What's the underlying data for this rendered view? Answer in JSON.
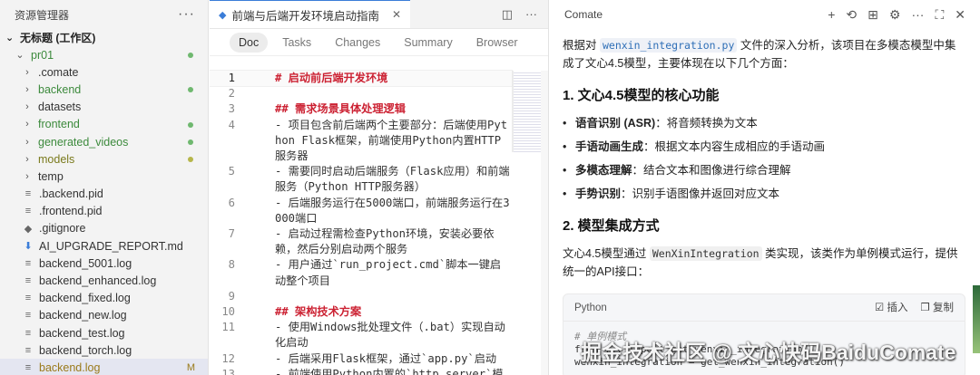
{
  "explorer": {
    "title": "资源管理器",
    "more": "···",
    "workspace": "无标题 (工作区)",
    "items": [
      {
        "label": "pr01",
        "type": "folder-open",
        "color": "green",
        "status": "dot-green"
      },
      {
        "label": ".comate",
        "type": "folder",
        "color": "normal",
        "status": ""
      },
      {
        "label": "backend",
        "type": "folder",
        "color": "green",
        "status": "dot-green"
      },
      {
        "label": "datasets",
        "type": "folder",
        "color": "normal",
        "status": ""
      },
      {
        "label": "frontend",
        "type": "folder",
        "color": "green",
        "status": "dot-green"
      },
      {
        "label": "generated_videos",
        "type": "folder",
        "color": "green",
        "status": "dot-green"
      },
      {
        "label": "models",
        "type": "folder",
        "color": "olive",
        "status": "dot-olive"
      },
      {
        "label": "temp",
        "type": "folder",
        "color": "normal",
        "status": ""
      },
      {
        "label": ".backend.pid",
        "type": "file",
        "color": "normal",
        "status": ""
      },
      {
        "label": ".frontend.pid",
        "type": "file",
        "color": "normal",
        "status": ""
      },
      {
        "label": ".gitignore",
        "type": "git",
        "color": "normal",
        "status": ""
      },
      {
        "label": "AI_UPGRADE_REPORT.md",
        "type": "md",
        "color": "normal",
        "status": ""
      },
      {
        "label": "backend_5001.log",
        "type": "file",
        "color": "normal",
        "status": ""
      },
      {
        "label": "backend_enhanced.log",
        "type": "file",
        "color": "normal",
        "status": ""
      },
      {
        "label": "backend_fixed.log",
        "type": "file",
        "color": "normal",
        "status": ""
      },
      {
        "label": "backend_new.log",
        "type": "file",
        "color": "normal",
        "status": ""
      },
      {
        "label": "backend_test.log",
        "type": "file",
        "color": "normal",
        "status": ""
      },
      {
        "label": "backend_torch.log",
        "type": "file",
        "color": "normal",
        "status": ""
      },
      {
        "label": "backend.log",
        "type": "file",
        "color": "modified",
        "status": "M"
      }
    ]
  },
  "editor": {
    "tab_title": "前端与后端开发环境启动指南",
    "view_tabs": [
      "Doc",
      "Tasks",
      "Changes",
      "Summary",
      "Browser"
    ],
    "active_view": "Doc",
    "lines": [
      {
        "n": "1",
        "text": "# 启动前后端开发环境",
        "heading": true,
        "current": true
      },
      {
        "n": "2",
        "text": "",
        "heading": false
      },
      {
        "n": "3",
        "text": "## 需求场景具体处理逻辑",
        "heading": true
      },
      {
        "n": "4",
        "text": "- 项目包含前后端两个主要部分：后端使用Python Flask框架，前端使用Python内置HTTP服务器",
        "heading": false
      },
      {
        "n": "5",
        "text": "- 需要同时启动后端服务（Flask应用）和前端服务（Python HTTP服务器）",
        "heading": false
      },
      {
        "n": "6",
        "text": "- 后端服务运行在5000端口，前端服务运行在3000端口",
        "heading": false
      },
      {
        "n": "7",
        "text": "- 启动过程需检查Python环境，安装必要依赖，然后分别启动两个服务",
        "heading": false
      },
      {
        "n": "8",
        "text": "- 用户通过`run_project.cmd`脚本一键启动整个项目",
        "heading": false
      },
      {
        "n": "9",
        "text": "",
        "heading": false
      },
      {
        "n": "10",
        "text": "## 架构技术方案",
        "heading": true
      },
      {
        "n": "11",
        "text": "- 使用Windows批处理文件（.bat）实现自动化启动",
        "heading": false
      },
      {
        "n": "12",
        "text": "- 后端采用Flask框架，通过`app.py`启动",
        "heading": false
      },
      {
        "n": "13",
        "text": "- 前端使用Python内置的`http.server`模",
        "heading": false
      }
    ]
  },
  "comate": {
    "title": "Comate",
    "intro_before": "根据对 ",
    "intro_code": "wenxin_integration.py",
    "intro_after": " 文件的深入分析，该项目在多模态模型中集成了文心4.5模型，主要体现在以下几个方面：",
    "h1": "1. 文心4.5模型的核心功能",
    "features": [
      {
        "name": "语音识别 (ASR)",
        "desc": "：将音频转换为文本"
      },
      {
        "name": "手语动画生成",
        "desc": "：根据文本内容生成相应的手语动画"
      },
      {
        "name": "多模态理解",
        "desc": "：结合文本和图像进行综合理解"
      },
      {
        "name": "手势识别",
        "desc": "：识别手语图像并返回对应文本"
      }
    ],
    "h2": "2. 模型集成方式",
    "p2_before": "文心4.5模型通过 ",
    "p2_code": "WenXinIntegration",
    "p2_after": " 类实现，该类作为单例模式运行，提供统一的API接口：",
    "code_lang": "Python",
    "insert_label": "插入",
    "copy_label": "复制",
    "code_comment": "# 单例模式",
    "code_line2": "from ... import get_wenxin_integration",
    "code_line3": "wenxin_integration = get_wenxin_integration()"
  },
  "watermark": "掘金技术社区 @ 文心快码BaiduComate"
}
